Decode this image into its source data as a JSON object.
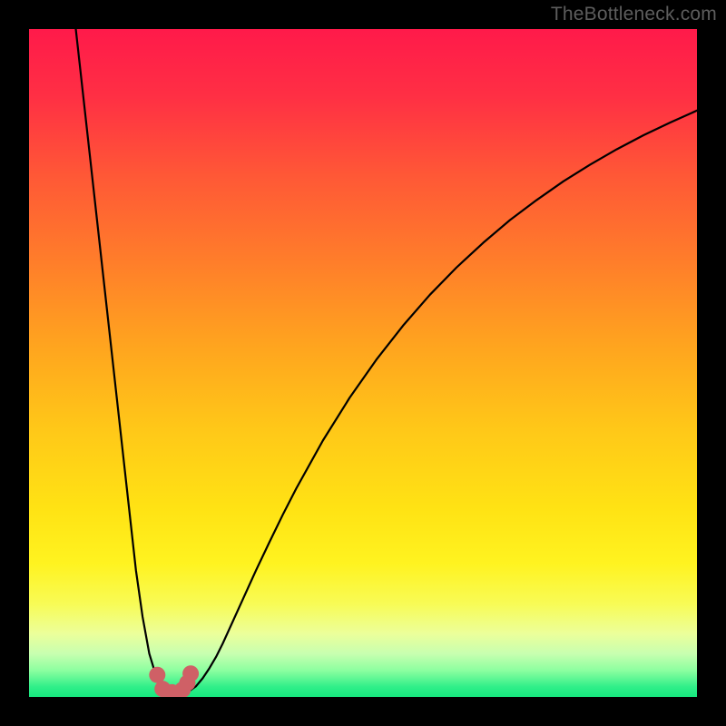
{
  "watermark": "TheBottleneck.com",
  "gradient_stops": [
    {
      "offset": 0.0,
      "color": "#ff1a4a"
    },
    {
      "offset": 0.1,
      "color": "#ff2f44"
    },
    {
      "offset": 0.22,
      "color": "#ff5836"
    },
    {
      "offset": 0.35,
      "color": "#ff7e2a"
    },
    {
      "offset": 0.48,
      "color": "#ffa61e"
    },
    {
      "offset": 0.6,
      "color": "#ffc818"
    },
    {
      "offset": 0.72,
      "color": "#ffe314"
    },
    {
      "offset": 0.8,
      "color": "#fff320"
    },
    {
      "offset": 0.86,
      "color": "#f8fb55"
    },
    {
      "offset": 0.905,
      "color": "#ecff9a"
    },
    {
      "offset": 0.935,
      "color": "#c8ffb0"
    },
    {
      "offset": 0.96,
      "color": "#8dffa0"
    },
    {
      "offset": 0.985,
      "color": "#30ef89"
    },
    {
      "offset": 1.0,
      "color": "#16e87f"
    }
  ],
  "curve_color": "#000000",
  "marker_color": "#cf6066",
  "chart_data": {
    "type": "line",
    "title": "",
    "xlabel": "",
    "ylabel": "",
    "xlim": [
      0,
      100
    ],
    "ylim": [
      0,
      100
    ],
    "grid": false,
    "legend": false,
    "series": [
      {
        "name": "bottleneck-curve",
        "x": [
          7,
          8,
          9,
          10,
          11,
          12,
          13,
          14,
          15,
          16,
          17,
          18,
          19,
          20,
          21,
          22,
          23,
          24,
          25,
          26,
          27,
          28,
          29,
          30,
          32,
          34,
          36,
          38,
          40,
          44,
          48,
          52,
          56,
          60,
          64,
          68,
          72,
          76,
          80,
          84,
          88,
          92,
          96,
          100
        ],
        "y": [
          100,
          91,
          82,
          73,
          64,
          55,
          46,
          37,
          28,
          19,
          12,
          6.5,
          3.2,
          1.6,
          0.9,
          0.6,
          0.6,
          0.9,
          1.6,
          2.8,
          4.3,
          6.0,
          8.0,
          10.2,
          14.6,
          19.0,
          23.2,
          27.3,
          31.2,
          38.4,
          44.8,
          50.5,
          55.6,
          60.2,
          64.3,
          68.0,
          71.4,
          74.4,
          77.2,
          79.7,
          82.0,
          84.1,
          86.0,
          87.8
        ]
      }
    ],
    "markers": {
      "name": "highlight-dots",
      "x": [
        19.2,
        20.0,
        21.4,
        23.0,
        23.7,
        24.2
      ],
      "y": [
        3.3,
        1.2,
        0.7,
        1.1,
        2.1,
        3.5
      ]
    }
  }
}
